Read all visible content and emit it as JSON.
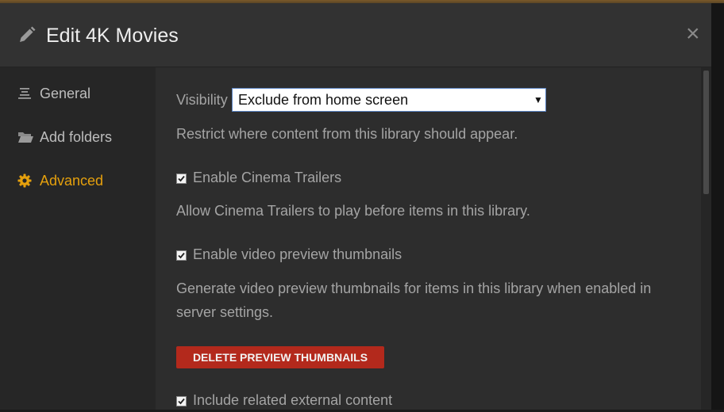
{
  "dialog": {
    "title": "Edit 4K Movies",
    "close_label": "×"
  },
  "sidebar": {
    "items": [
      {
        "label": "General",
        "icon": "list-icon"
      },
      {
        "label": "Add folders",
        "icon": "folder-icon"
      },
      {
        "label": "Advanced",
        "icon": "gear-icon",
        "active": true
      }
    ]
  },
  "advanced": {
    "visibility_label": "Visibility",
    "visibility_value": "Exclude from home screen",
    "visibility_help": "Restrict where content from this library should appear.",
    "cinema_trailers_label": "Enable Cinema Trailers",
    "cinema_trailers_checked": true,
    "cinema_trailers_help": "Allow Cinema Trailers to play before items in this library.",
    "preview_thumbnails_label": "Enable video preview thumbnails",
    "preview_thumbnails_checked": true,
    "preview_thumbnails_help_line1": "Generate video preview thumbnails for items in this library when enabled in",
    "preview_thumbnails_help_line2": "server settings.",
    "delete_button": "DELETE PREVIEW THUMBNAILS",
    "related_content_label": "Include related external content",
    "related_content_checked": true
  },
  "colors": {
    "accent": "#e5a00d",
    "danger": "#b3291c",
    "background": "#2d2d2d"
  }
}
